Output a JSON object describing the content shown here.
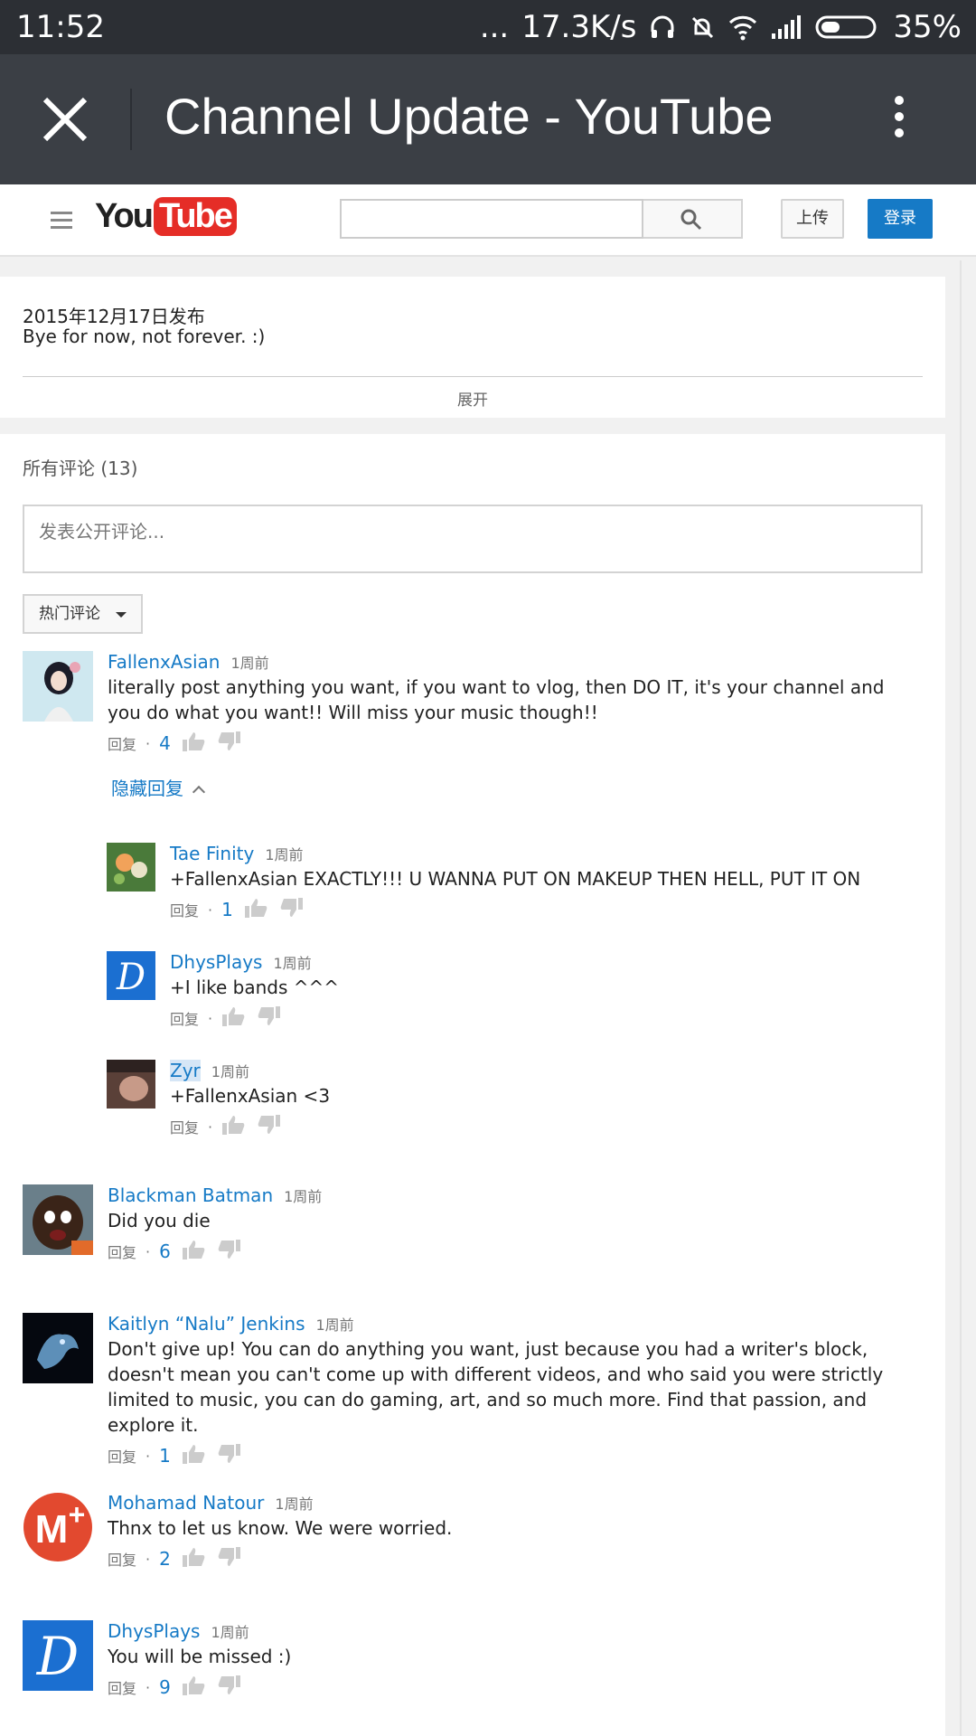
{
  "status_bar": {
    "time": "11:52",
    "dots": "...",
    "speed": "17.3K/s",
    "battery": "35%"
  },
  "title_bar": {
    "title": "Channel Update - YouTube"
  },
  "youtube_header": {
    "logo_you": "You",
    "logo_tube": "Tube",
    "upload_label": "上传",
    "login_label": "登录",
    "colors": {
      "login_bg": "#167ac6",
      "logo_red": "#e52d27"
    }
  },
  "description": {
    "date": "2015年12月17日发布",
    "text": "Bye for now, not forever. :)",
    "expand_label": "展开"
  },
  "comments_section": {
    "header": "所有评论 (13)",
    "input_placeholder": "发表公开评论...",
    "sort_label": "热门评论",
    "hide_replies_label": "隐藏回复",
    "reply_label": "回复",
    "dot": "·",
    "comments": [
      {
        "author": "FallenxAsian",
        "time": "1周前",
        "text": "literally post anything you want, if you want to vlog, then DO IT, it's your channel and you do what you want!! Will miss your music though!!",
        "likes": "4"
      },
      {
        "author": "Blackman Batman",
        "time": "1周前",
        "text": "Did you die",
        "likes": "6"
      },
      {
        "author": "Kaitlyn “Nalu” Jenkins",
        "time": "1周前",
        "text": "Don't give up! You can do anything you want, just because you had a writer's block, doesn't mean you can't come up with different videos, and who said you were strictly limited to music, you can do gaming, art, and so much more. Find that passion, and explore it.",
        "likes": "1"
      },
      {
        "author": "Mohamad Natour",
        "time": "1周前",
        "text": "Thnx to let us know. We were worried.",
        "likes": "2"
      },
      {
        "author": "DhysPlays",
        "time": "1周前",
        "text": "You will be missed :)",
        "likes": "9"
      }
    ],
    "replies": [
      {
        "author": "Tae Finity",
        "time": "1周前",
        "text": "+FallenxAsian EXACTLY!!! U WANNA PUT ON MAKEUP THEN HELL, PUT IT ON",
        "likes": "1"
      },
      {
        "author": "DhysPlays",
        "time": "1周前",
        "text": "+I like bands ^^^",
        "likes": ""
      },
      {
        "author": "Zyr",
        "time": "1周前",
        "text": "+FallenxAsian <3",
        "likes": ""
      }
    ]
  }
}
